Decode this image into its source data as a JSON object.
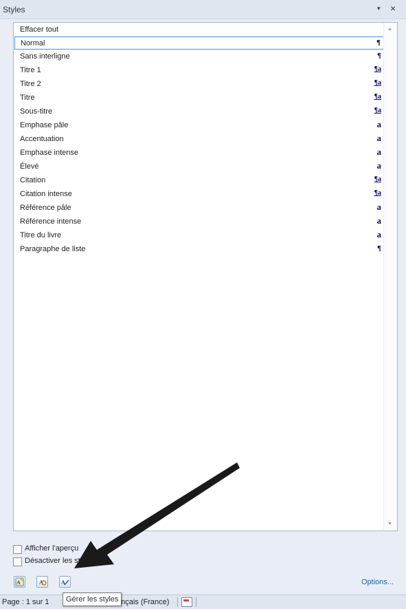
{
  "pane": {
    "title": "Styles",
    "dropdown_glyph": "▾",
    "close_glyph": "×"
  },
  "styles": [
    {
      "label": "Effacer tout",
      "glyph": ""
    },
    {
      "label": "Normal",
      "glyph": "¶",
      "selected": true
    },
    {
      "label": "Sans interligne",
      "glyph": "¶"
    },
    {
      "label": "Titre 1",
      "glyph": "¶a"
    },
    {
      "label": "Titre 2",
      "glyph": "¶a"
    },
    {
      "label": "Titre",
      "glyph": "¶a"
    },
    {
      "label": "Sous-titre",
      "glyph": "¶a"
    },
    {
      "label": "Emphase pâle",
      "glyph": "a"
    },
    {
      "label": "Accentuation",
      "glyph": "a"
    },
    {
      "label": "Emphase intense",
      "glyph": "a"
    },
    {
      "label": "Élevé",
      "glyph": "a"
    },
    {
      "label": "Citation",
      "glyph": "¶a"
    },
    {
      "label": "Citation intense",
      "glyph": "¶a"
    },
    {
      "label": "Référence pâle",
      "glyph": "a"
    },
    {
      "label": "Référence intense",
      "glyph": "a"
    },
    {
      "label": "Titre du livre",
      "glyph": "a"
    },
    {
      "label": "Paragraphe de liste",
      "glyph": "¶"
    }
  ],
  "options": {
    "show_preview": {
      "label": "Afficher l'aperçu",
      "checked": false
    },
    "disable_linked": {
      "label": "Désactiver les sty",
      "checked": false
    }
  },
  "toolbar": {
    "new_style_icon": "new-style-icon",
    "style_inspector_icon": "style-inspector-icon",
    "manage_styles_icon": "manage-styles-icon",
    "options_link": "Options..."
  },
  "tooltip": "Gérer les styles",
  "statusbar": {
    "page": "Page : 1 sur 1",
    "language": "ançais (France)"
  },
  "colors": {
    "pane_bg": "#e9eef6",
    "selection_border": "#4a8fd4",
    "glyph": "#0c0c6a",
    "link": "#1f5ea8"
  }
}
